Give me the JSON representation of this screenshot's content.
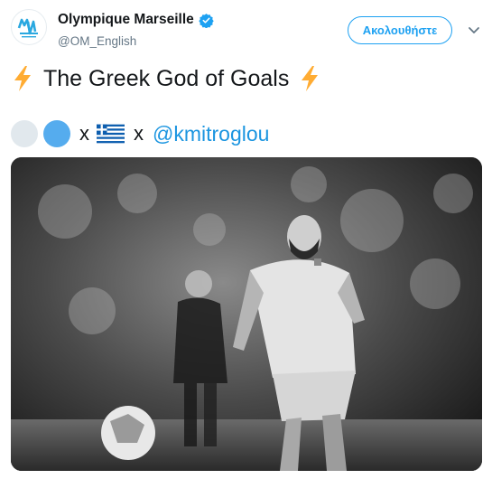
{
  "account": {
    "display_name": "Olympique Marseille",
    "handle": "@OM_English",
    "verified": true,
    "avatar_icon": "om-crest-icon"
  },
  "follow_button": {
    "label": "Ακολουθήστε"
  },
  "tweet": {
    "line1": "The Greek God of Goals",
    "line1_emoji": "lightning-emoji",
    "line2_separator_1": "x",
    "line2_separator_2": "x",
    "mention": "@kmitroglou",
    "flag_emoji": "greece-flag-emoji"
  },
  "colors": {
    "accent": "#1da1f2",
    "link": "#1b95e0",
    "verified": "#1da1f2",
    "bolt": "#ffac33"
  }
}
